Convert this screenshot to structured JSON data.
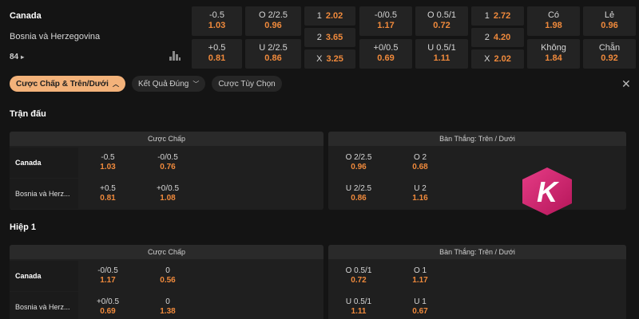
{
  "match": {
    "team1": "Canada",
    "team2": "Bosnia và Herzegovina",
    "more_markets": "84",
    "more_icon": "chevron-right-icon"
  },
  "top_odds": {
    "handicap": [
      {
        "label": "-0.5",
        "value": "1.03"
      },
      {
        "label": "+0.5",
        "value": "0.81"
      }
    ],
    "over_under": [
      {
        "label": "O 2/2.5",
        "value": "0.96"
      },
      {
        "label": "U 2/2.5",
        "value": "0.86"
      }
    ],
    "result_1x2": [
      {
        "label": "1",
        "value": "2.02"
      },
      {
        "label": "2",
        "value": "3.65"
      },
      {
        "label": "X",
        "value": "3.25"
      }
    ],
    "half_handicap": [
      {
        "label": "-0/0.5",
        "value": "1.17"
      },
      {
        "label": "+0/0.5",
        "value": "0.69"
      }
    ],
    "half_over_under": [
      {
        "label": "O 0.5/1",
        "value": "0.72"
      },
      {
        "label": "U 0.5/1",
        "value": "1.11"
      }
    ],
    "half_1x2": [
      {
        "label": "1",
        "value": "2.72"
      },
      {
        "label": "2",
        "value": "4.20"
      },
      {
        "label": "X",
        "value": "2.02"
      }
    ],
    "btts": [
      {
        "label": "Có",
        "value": "1.98"
      },
      {
        "label": "Không",
        "value": "1.84"
      }
    ],
    "odd_even": [
      {
        "label": "Lẻ",
        "value": "0.96"
      },
      {
        "label": "Chẵn",
        "value": "0.92"
      }
    ]
  },
  "filters": {
    "chips": [
      {
        "label": "Cược Chấp & Trên/Dưới",
        "active": true
      },
      {
        "label": "Kết Quả Đúng",
        "active": false
      },
      {
        "label": "Cược Tùy Chọn",
        "active": false
      }
    ]
  },
  "sections": [
    {
      "title": "Trận đấu",
      "handicap_header": "Cược Chấp",
      "ou_header": "Bàn Thắng: Trên / Dưới",
      "rows": [
        {
          "team": "Canada",
          "handicap": [
            {
              "label": "-0.5",
              "value": "1.03"
            },
            {
              "label": "-0/0.5",
              "value": "0.76"
            }
          ],
          "ou": [
            {
              "label": "O 2/2.5",
              "value": "0.96"
            },
            {
              "label": "O 2",
              "value": "0.68"
            }
          ]
        },
        {
          "team": "Bosnia và Herz...",
          "handicap": [
            {
              "label": "+0.5",
              "value": "0.81"
            },
            {
              "label": "+0/0.5",
              "value": "1.08"
            }
          ],
          "ou": [
            {
              "label": "U 2/2.5",
              "value": "0.86"
            },
            {
              "label": "U 2",
              "value": "1.16"
            }
          ]
        }
      ]
    },
    {
      "title": "Hiệp 1",
      "handicap_header": "Cược Chấp",
      "ou_header": "Bàn Thắng: Trên / Dưới",
      "rows": [
        {
          "team": "Canada",
          "handicap": [
            {
              "label": "-0/0.5",
              "value": "1.17"
            },
            {
              "label": "0",
              "value": "0.56"
            }
          ],
          "ou": [
            {
              "label": "O 0.5/1",
              "value": "0.72"
            },
            {
              "label": "O 1",
              "value": "1.17"
            }
          ]
        },
        {
          "team": "Bosnia và Herz...",
          "handicap": [
            {
              "label": "+0/0.5",
              "value": "0.69"
            },
            {
              "label": "0",
              "value": "1.38"
            }
          ],
          "ou": [
            {
              "label": "U 0.5/1",
              "value": "1.11"
            },
            {
              "label": "U 1",
              "value": "0.67"
            }
          ]
        }
      ]
    }
  ],
  "colors": {
    "odds_value": "#f08a3c",
    "active_chip": "#f3b27a",
    "logo": "#d6246e"
  },
  "logo": {
    "letter": "K"
  }
}
